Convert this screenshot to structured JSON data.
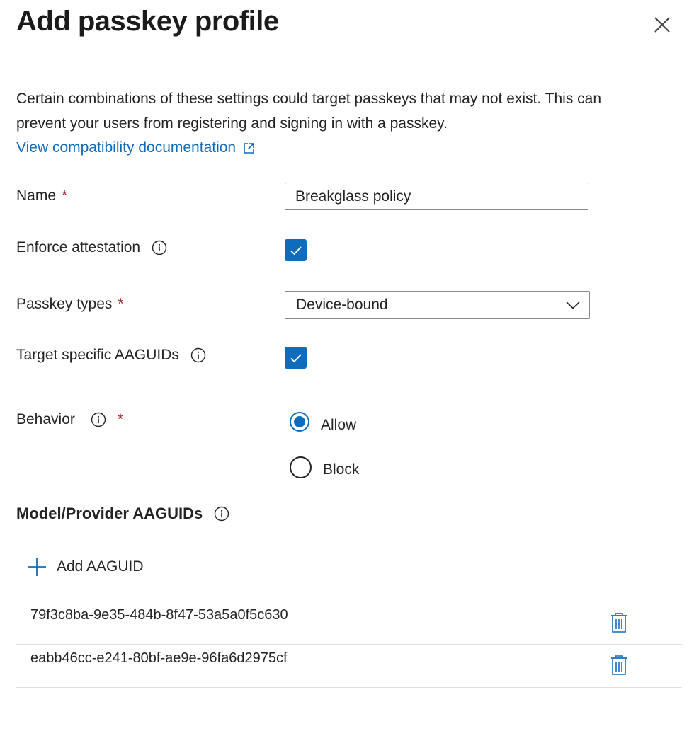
{
  "panel": {
    "title": "Add passkey profile",
    "description": "Certain combinations of these settings could target passkeys that may not exist. This can prevent your users from registering and signing in with a passkey.",
    "doc_link": "View compatibility documentation"
  },
  "form": {
    "name": {
      "label": "Name",
      "required": "*",
      "value": "Breakglass policy"
    },
    "enforce_attestation": {
      "label": "Enforce attestation",
      "checked": true
    },
    "passkey_types": {
      "label": "Passkey types",
      "required": "*",
      "selected": "Device-bound"
    },
    "target_aaguids": {
      "label": "Target specific AAGUIDs",
      "checked": true
    },
    "behavior": {
      "label": "Behavior",
      "required": "*",
      "options": [
        {
          "label": "Allow",
          "selected": true
        },
        {
          "label": "Block",
          "selected": false
        }
      ]
    }
  },
  "aaguids": {
    "heading": "Model/Provider AAGUIDs",
    "add_label": "Add AAGUID",
    "items": [
      "79f3c8ba-9e35-484b-8f47-53a5a0f5c630",
      "eabb46cc-e241-80bf-ae9e-96fa6d2975cf"
    ]
  },
  "colors": {
    "accent": "#0f6cbd",
    "required": "#a4262c",
    "text": "#242424",
    "border": "#8a8886",
    "divider": "#e1dfdd"
  },
  "icons": [
    "close-icon",
    "external-link-icon",
    "info-icon",
    "check-icon",
    "chevron-down-icon",
    "plus-icon",
    "trash-icon"
  ]
}
